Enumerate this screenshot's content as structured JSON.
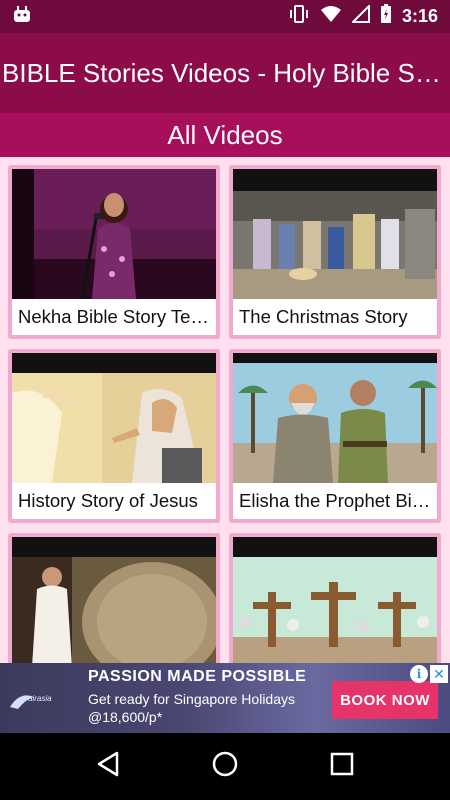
{
  "status_bar": {
    "time": "3:16",
    "icons": [
      "android-notification-icon",
      "vibrate-icon",
      "wifi-icon",
      "signal-icon",
      "battery-icon"
    ]
  },
  "app_bar": {
    "title": "BIBLE Stories Videos - Holy Bible Stories"
  },
  "sub_bar": {
    "title": "All Videos"
  },
  "videos": [
    {
      "title": "Nekha Bible Story Telling"
    },
    {
      "title": "The Christmas Story"
    },
    {
      "title": "History Story of Jesus"
    },
    {
      "title": "Elisha the Prophet Bible Story"
    },
    {
      "title": ""
    },
    {
      "title": ""
    }
  ],
  "ad": {
    "headline": "PASSION MADE POSSIBLE",
    "line1": "Get ready for Singapore Holidays",
    "line2": "@18,600/p*",
    "cta": "BOOK NOW",
    "logo_text": "AirAsia",
    "colors": {
      "cta": "#e6336a",
      "background": "#4a4672"
    }
  },
  "nav_bar": {
    "buttons": [
      "back-icon",
      "home-icon",
      "recents-icon"
    ]
  },
  "colors": {
    "status_bar": "#6e0a3c",
    "app_bar": "#8c0c4a",
    "sub_bar": "#a80f5a",
    "grid_bg": "#ffe0ee",
    "card_border": "#f3a9cf"
  }
}
